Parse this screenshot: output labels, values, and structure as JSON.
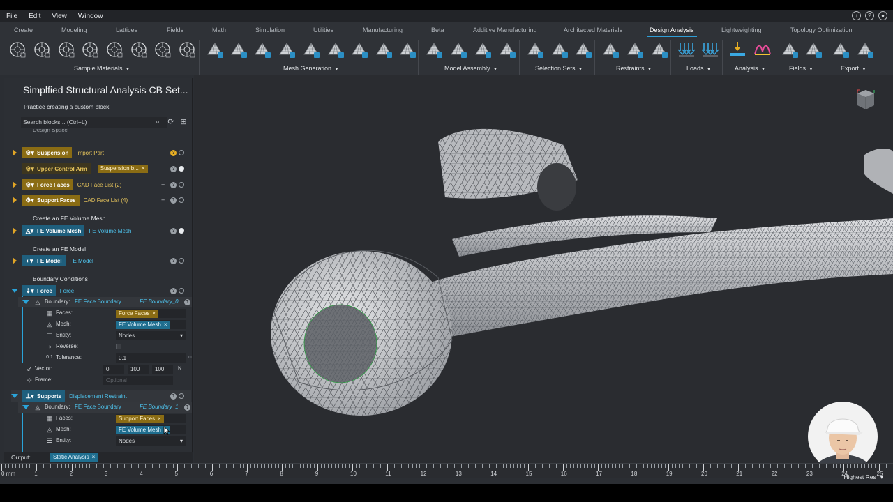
{
  "menubar": {
    "items": [
      "File",
      "Edit",
      "View",
      "Window"
    ]
  },
  "ribbon": {
    "tabs": [
      "Create",
      "Modeling",
      "Lattices",
      "Fields",
      "Math",
      "Simulation",
      "Utilities",
      "Manufacturing",
      "Beta",
      "Additive Manufacturing",
      "Architected Materials",
      "Design Analysis",
      "Lightweighting",
      "Topology Optimization"
    ],
    "active_tab": "Design Analysis",
    "groups": [
      "Sample Materials",
      "Mesh Generation",
      "Model Assembly",
      "Selection Sets",
      "Restraints",
      "Loads",
      "Analysis",
      "Fields",
      "Export"
    ]
  },
  "panel": {
    "title": "Simplfied Structural Analysis CB Set...",
    "description": "Practice creating a custom block.",
    "search_placeholder": "Search blocks... (Ctrl+L)",
    "cut_label": "Design Space",
    "blocks": [
      {
        "head": "Suspension",
        "value": "Import Part"
      },
      {
        "head": "Upper Control Arm",
        "value": "Suspension.b..."
      },
      {
        "head": "Force Faces",
        "value": "CAD Face List (2)"
      },
      {
        "head": "Support Faces",
        "value": "CAD Face List (4)"
      }
    ],
    "section_mesh": "Create an FE Volume Mesh",
    "mesh_block": {
      "head": "FE Volume Mesh",
      "value": "FE Volume Mesh"
    },
    "section_model": "Create an FE Model",
    "model_block": {
      "head": "FE Model",
      "value": "FE Model"
    },
    "section_bc": "Boundary Conditions",
    "force_block": {
      "head": "Force",
      "value": "Force",
      "boundary_label": "Boundary:",
      "boundary_value": "FE Face Boundary",
      "boundary_name": "FE Boundary_0",
      "faces_label": "Faces:",
      "faces_value": "Force Faces",
      "mesh_label": "Mesh:",
      "mesh_value": "FE Volume Mesh",
      "entity_label": "Entity:",
      "entity_value": "Nodes",
      "reverse_label": "Reverse:",
      "tolerance_label": "Tolerance:",
      "tolerance_value": "0.1",
      "tolerance_unit": "mm",
      "vector_label": "Vector:",
      "vector": [
        "0",
        "100",
        "100"
      ],
      "vector_unit": "N",
      "frame_label": "Frame:",
      "frame_placeholder": "Optional"
    },
    "supports_block": {
      "head": "Supports",
      "value": "Displacement Restraint",
      "boundary_label": "Boundary:",
      "boundary_value": "FE Face Boundary",
      "boundary_name": "FE Boundary_1",
      "faces_label": "Faces:",
      "faces_value": "Support Faces",
      "mesh_label": "Mesh:",
      "mesh_value": "FE Volume Mesh",
      "entity_label": "Entity:",
      "entity_value": "Nodes"
    }
  },
  "output": {
    "label": "Output:",
    "value": "Static Analysis"
  },
  "ruler": {
    "unit_label": "0 mm",
    "numbers": [
      "1",
      "2",
      "3",
      "4",
      "5",
      "6",
      "7",
      "8",
      "9",
      "10",
      "11",
      "12",
      "13",
      "14",
      "15",
      "16",
      "17",
      "18",
      "19",
      "20",
      "21",
      "22",
      "23",
      "24",
      "25"
    ]
  },
  "status": {
    "resolution": "Highest Res"
  },
  "colors": {
    "accent": "#2f9ed6",
    "yellow_block": "#8a6c14",
    "blue_block": "#1f5f7d",
    "background": "#2b2e33"
  }
}
